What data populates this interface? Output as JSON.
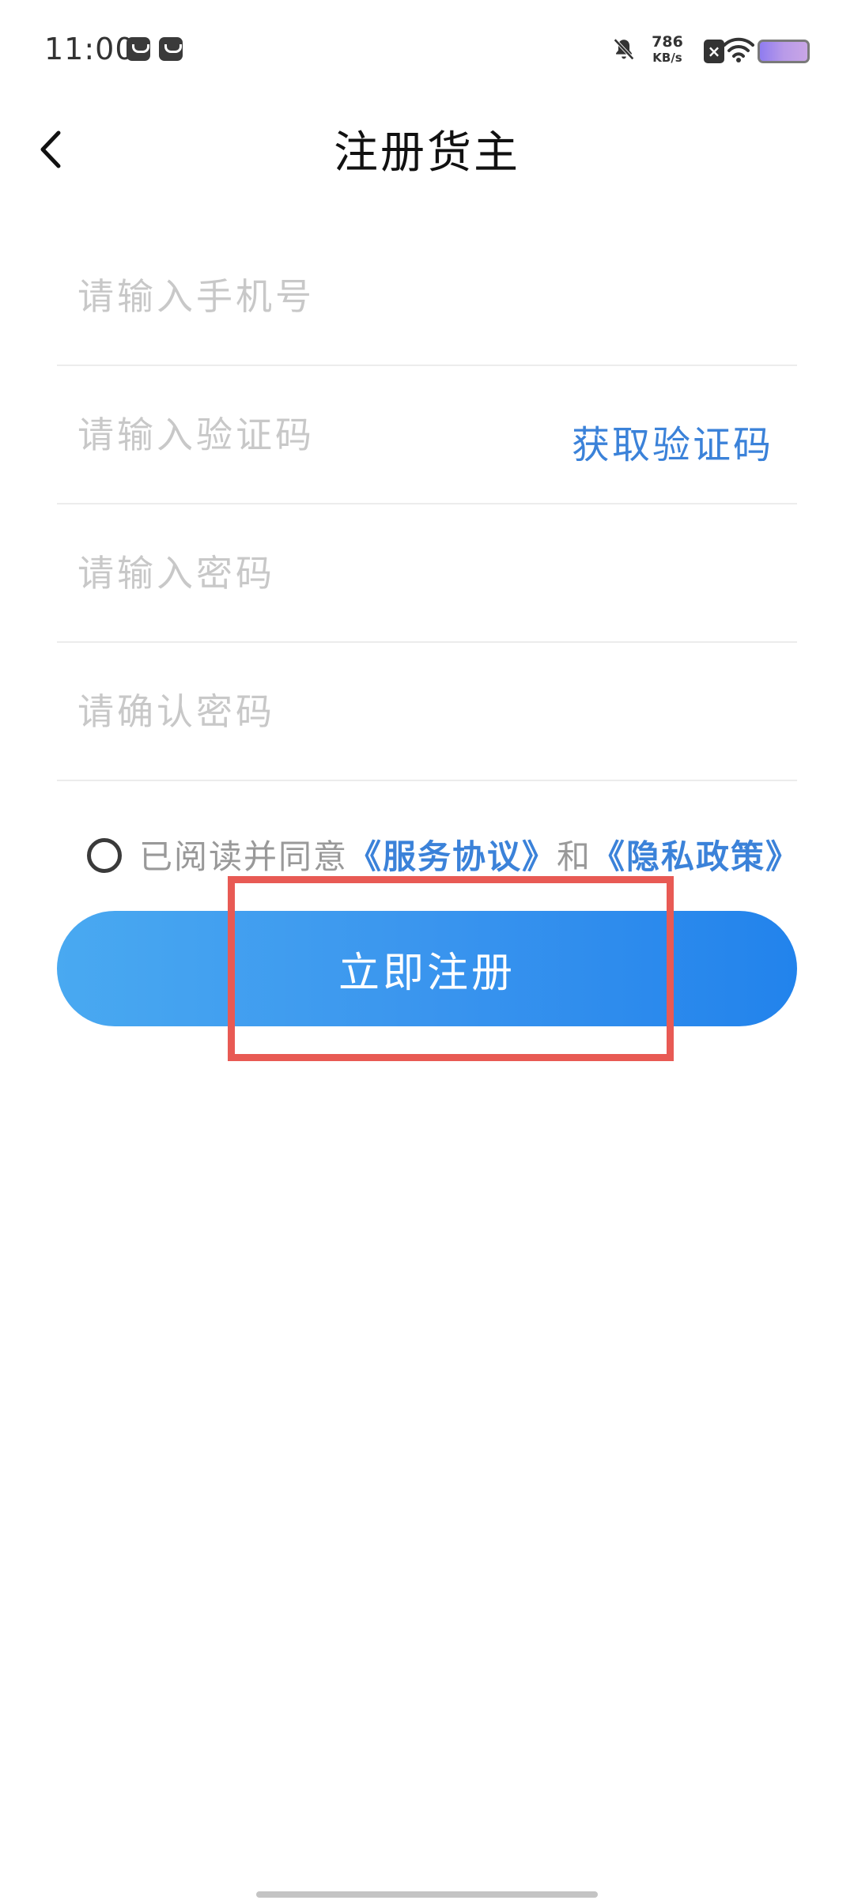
{
  "status_bar": {
    "time": "11:00",
    "net_speed": "786",
    "net_speed_unit": "KB/s"
  },
  "header": {
    "title": "注册货主"
  },
  "form": {
    "phone_placeholder": "请输入手机号",
    "code_placeholder": "请输入验证码",
    "get_code_label": "获取验证码",
    "password_placeholder": "请输入密码",
    "confirm_placeholder": "请确认密码"
  },
  "agreement": {
    "prefix": "已阅读并同意",
    "service_link": "《服务协议》",
    "and": "和",
    "privacy_link": "《隐私政策》"
  },
  "register_label": "立即注册",
  "colors": {
    "accent": "#3b82d9",
    "button_start": "#49a9f1",
    "button_end": "#2283ec",
    "highlight": "#e85a54"
  }
}
